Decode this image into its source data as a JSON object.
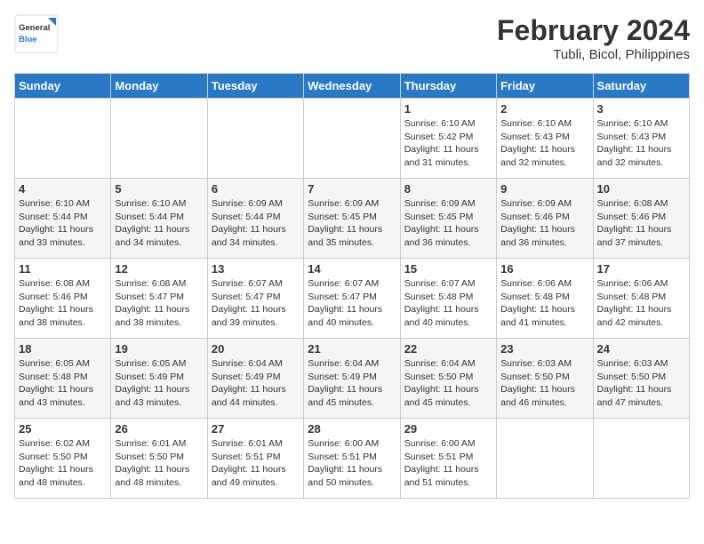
{
  "logo": {
    "text_general": "General",
    "text_blue": "Blue"
  },
  "header": {
    "month": "February 2024",
    "location": "Tubli, Bicol, Philippines"
  },
  "days_of_week": [
    "Sunday",
    "Monday",
    "Tuesday",
    "Wednesday",
    "Thursday",
    "Friday",
    "Saturday"
  ],
  "weeks": [
    [
      {
        "day": "",
        "info": ""
      },
      {
        "day": "",
        "info": ""
      },
      {
        "day": "",
        "info": ""
      },
      {
        "day": "",
        "info": ""
      },
      {
        "day": "1",
        "info": "Sunrise: 6:10 AM\nSunset: 5:42 PM\nDaylight: 11 hours and 31 minutes."
      },
      {
        "day": "2",
        "info": "Sunrise: 6:10 AM\nSunset: 5:43 PM\nDaylight: 11 hours and 32 minutes."
      },
      {
        "day": "3",
        "info": "Sunrise: 6:10 AM\nSunset: 5:43 PM\nDaylight: 11 hours and 32 minutes."
      }
    ],
    [
      {
        "day": "4",
        "info": "Sunrise: 6:10 AM\nSunset: 5:44 PM\nDaylight: 11 hours and 33 minutes."
      },
      {
        "day": "5",
        "info": "Sunrise: 6:10 AM\nSunset: 5:44 PM\nDaylight: 11 hours and 34 minutes."
      },
      {
        "day": "6",
        "info": "Sunrise: 6:09 AM\nSunset: 5:44 PM\nDaylight: 11 hours and 34 minutes."
      },
      {
        "day": "7",
        "info": "Sunrise: 6:09 AM\nSunset: 5:45 PM\nDaylight: 11 hours and 35 minutes."
      },
      {
        "day": "8",
        "info": "Sunrise: 6:09 AM\nSunset: 5:45 PM\nDaylight: 11 hours and 36 minutes."
      },
      {
        "day": "9",
        "info": "Sunrise: 6:09 AM\nSunset: 5:46 PM\nDaylight: 11 hours and 36 minutes."
      },
      {
        "day": "10",
        "info": "Sunrise: 6:08 AM\nSunset: 5:46 PM\nDaylight: 11 hours and 37 minutes."
      }
    ],
    [
      {
        "day": "11",
        "info": "Sunrise: 6:08 AM\nSunset: 5:46 PM\nDaylight: 11 hours and 38 minutes."
      },
      {
        "day": "12",
        "info": "Sunrise: 6:08 AM\nSunset: 5:47 PM\nDaylight: 11 hours and 38 minutes."
      },
      {
        "day": "13",
        "info": "Sunrise: 6:07 AM\nSunset: 5:47 PM\nDaylight: 11 hours and 39 minutes."
      },
      {
        "day": "14",
        "info": "Sunrise: 6:07 AM\nSunset: 5:47 PM\nDaylight: 11 hours and 40 minutes."
      },
      {
        "day": "15",
        "info": "Sunrise: 6:07 AM\nSunset: 5:48 PM\nDaylight: 11 hours and 40 minutes."
      },
      {
        "day": "16",
        "info": "Sunrise: 6:06 AM\nSunset: 5:48 PM\nDaylight: 11 hours and 41 minutes."
      },
      {
        "day": "17",
        "info": "Sunrise: 6:06 AM\nSunset: 5:48 PM\nDaylight: 11 hours and 42 minutes."
      }
    ],
    [
      {
        "day": "18",
        "info": "Sunrise: 6:05 AM\nSunset: 5:48 PM\nDaylight: 11 hours and 43 minutes."
      },
      {
        "day": "19",
        "info": "Sunrise: 6:05 AM\nSunset: 5:49 PM\nDaylight: 11 hours and 43 minutes."
      },
      {
        "day": "20",
        "info": "Sunrise: 6:04 AM\nSunset: 5:49 PM\nDaylight: 11 hours and 44 minutes."
      },
      {
        "day": "21",
        "info": "Sunrise: 6:04 AM\nSunset: 5:49 PM\nDaylight: 11 hours and 45 minutes."
      },
      {
        "day": "22",
        "info": "Sunrise: 6:04 AM\nSunset: 5:50 PM\nDaylight: 11 hours and 45 minutes."
      },
      {
        "day": "23",
        "info": "Sunrise: 6:03 AM\nSunset: 5:50 PM\nDaylight: 11 hours and 46 minutes."
      },
      {
        "day": "24",
        "info": "Sunrise: 6:03 AM\nSunset: 5:50 PM\nDaylight: 11 hours and 47 minutes."
      }
    ],
    [
      {
        "day": "25",
        "info": "Sunrise: 6:02 AM\nSunset: 5:50 PM\nDaylight: 11 hours and 48 minutes."
      },
      {
        "day": "26",
        "info": "Sunrise: 6:01 AM\nSunset: 5:50 PM\nDaylight: 11 hours and 48 minutes."
      },
      {
        "day": "27",
        "info": "Sunrise: 6:01 AM\nSunset: 5:51 PM\nDaylight: 11 hours and 49 minutes."
      },
      {
        "day": "28",
        "info": "Sunrise: 6:00 AM\nSunset: 5:51 PM\nDaylight: 11 hours and 50 minutes."
      },
      {
        "day": "29",
        "info": "Sunrise: 6:00 AM\nSunset: 5:51 PM\nDaylight: 11 hours and 51 minutes."
      },
      {
        "day": "",
        "info": ""
      },
      {
        "day": "",
        "info": ""
      }
    ]
  ]
}
